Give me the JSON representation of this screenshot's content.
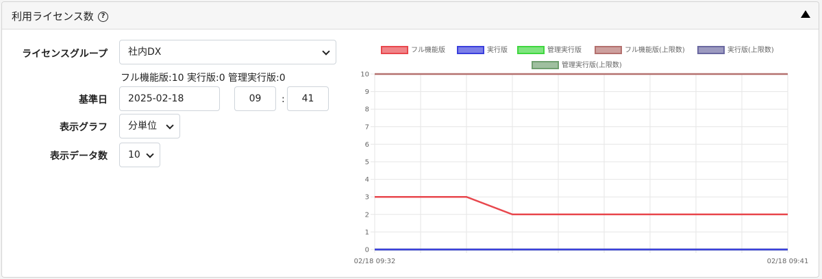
{
  "header": {
    "title": "利用ライセンス数",
    "help_glyph": "?"
  },
  "form": {
    "license_group_label": "ライセンスグループ",
    "license_group_value": "社内DX",
    "license_info": "フル機能版:10 実行版:0 管理実行版:0",
    "base_date_label": "基準日",
    "base_date_value": "2025-02-18",
    "hour_value": "09",
    "time_separator": ":",
    "minute_value": "41",
    "graph_label": "表示グラフ",
    "graph_value": "分単位",
    "count_label": "表示データ数",
    "count_value": "10"
  },
  "colors": {
    "full": "#e8474d",
    "exec": "#3a3fdc",
    "mgmt": "#3fd63f",
    "full_limit": "#b4706e",
    "exec_limit": "#6a68a0",
    "mgmt_limit": "#6f9f6f"
  },
  "chart_data": {
    "type": "line",
    "x": [
      "02/18 09:32",
      "02/18 09:33",
      "02/18 09:34",
      "02/18 09:35",
      "02/18 09:36",
      "02/18 09:37",
      "02/18 09:38",
      "02/18 09:39",
      "02/18 09:40",
      "02/18 09:41"
    ],
    "x_tick_labels": [
      "02/18 09:32",
      "02/18 09:41"
    ],
    "ylim": [
      0,
      10
    ],
    "y_ticks": [
      "0",
      "1",
      "2",
      "3",
      "4",
      "5",
      "6",
      "7",
      "8",
      "9",
      "10"
    ],
    "grid": true,
    "legend_position": "top",
    "series": [
      {
        "name": "フル機能版",
        "color_key": "full",
        "values": [
          3,
          3,
          3,
          2,
          2,
          2,
          2,
          2,
          2,
          2
        ]
      },
      {
        "name": "実行版",
        "color_key": "exec",
        "values": [
          0,
          0,
          0,
          0,
          0,
          0,
          0,
          0,
          0,
          0
        ]
      },
      {
        "name": "管理実行版",
        "color_key": "mgmt",
        "values": [
          0,
          0,
          0,
          0,
          0,
          0,
          0,
          0,
          0,
          0
        ]
      },
      {
        "name": "フル機能版(上限数)",
        "color_key": "full_limit",
        "values": [
          10,
          10,
          10,
          10,
          10,
          10,
          10,
          10,
          10,
          10
        ]
      },
      {
        "name": "実行版(上限数)",
        "color_key": "exec_limit",
        "values": [
          0,
          0,
          0,
          0,
          0,
          0,
          0,
          0,
          0,
          0
        ]
      },
      {
        "name": "管理実行版(上限数)",
        "color_key": "mgmt_limit",
        "values": [
          0,
          0,
          0,
          0,
          0,
          0,
          0,
          0,
          0,
          0
        ]
      }
    ]
  }
}
